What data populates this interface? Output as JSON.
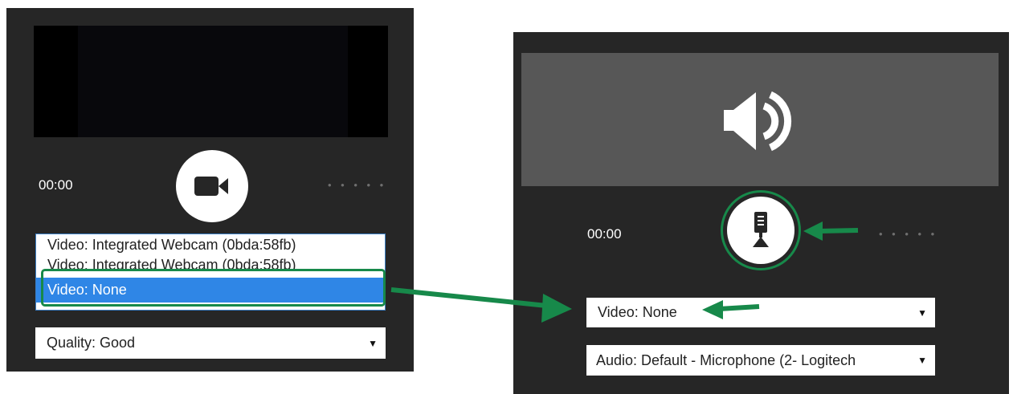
{
  "left_panel": {
    "time": "00:00",
    "dots": "• • • • •",
    "camera_button_icon": "video-camera-icon",
    "video_options": [
      "Video: Integrated Webcam (0bda:58fb)",
      "Video: Integrated Webcam (0bda:58fb)",
      "Video: None"
    ],
    "quality_select": "Quality: Good"
  },
  "right_panel": {
    "speaker_icon": "speaker-icon",
    "time": "00:00",
    "dots": "• • • • •",
    "mic_button_icon": "microphone-icon",
    "video_select": "Video: None",
    "audio_select": "Audio: Default - Microphone (2- Logitech"
  },
  "colors": {
    "panel_bg": "#262626",
    "selection_blue": "#2f86e6",
    "annotation_green": "#17894a",
    "speaker_area": "#575757"
  }
}
